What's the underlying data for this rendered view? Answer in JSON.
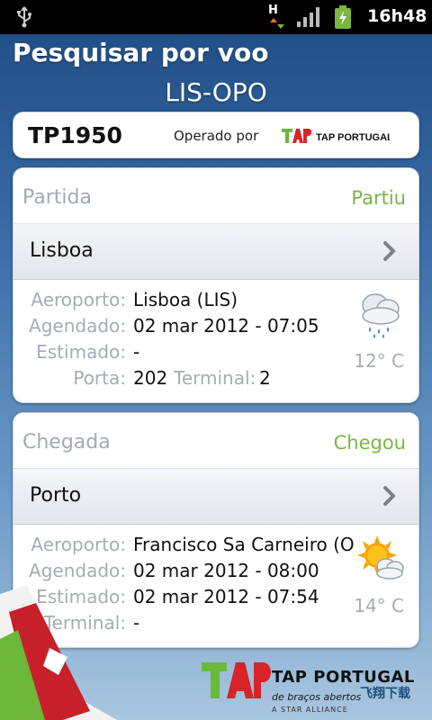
{
  "status_bar": {
    "network_type": "H",
    "time": "16h48",
    "icons": [
      "usb-icon",
      "data-arrows-icon",
      "signal-icon",
      "battery-charging-icon"
    ]
  },
  "header": {
    "title": "Pesquisar por voo",
    "route": "LIS-OPO"
  },
  "flight": {
    "number": "TP1950",
    "operated_by_label": "Operado por",
    "airline_logo_text": "TAP PORTUGAL"
  },
  "colors": {
    "status_green": "#7ab642",
    "label_gray": "#a6acb3",
    "tap_red": "#d8232a",
    "tap_green": "#6bb83a"
  },
  "departure": {
    "section_label": "Partida",
    "status": "Partiu",
    "city": "Lisboa",
    "airport_label": "Aeroporto:",
    "airport": "Lisboa (LIS)",
    "scheduled_label": "Agendado:",
    "scheduled": "02 mar 2012 - 07:05",
    "estimated_label": "Estimado:",
    "estimated": "-",
    "gate_label": "Porta:",
    "gate": "202",
    "terminal_label": "Terminal:",
    "terminal": "2",
    "weather_icon": "rain-cloud-icon",
    "temperature": "12° C"
  },
  "arrival": {
    "section_label": "Chegada",
    "status": "Chegou",
    "city": "Porto",
    "airport_label": "Aeroporto:",
    "airport": "Francisco Sa Carneiro (O...",
    "scheduled_label": "Agendado:",
    "scheduled": "02 mar 2012 - 08:00",
    "estimated_label": "Estimado:",
    "estimated": "02 mar 2012 - 07:54",
    "terminal_label": "Terminal:",
    "terminal": "-",
    "weather_icon": "partly-cloudy-icon",
    "temperature": "14° C"
  },
  "footer": {
    "brand": "TAP PORTUGAL",
    "tagline": "de braços abertos",
    "sub": "A STAR ALLIANCE",
    "watermark": "飞翔下载"
  }
}
